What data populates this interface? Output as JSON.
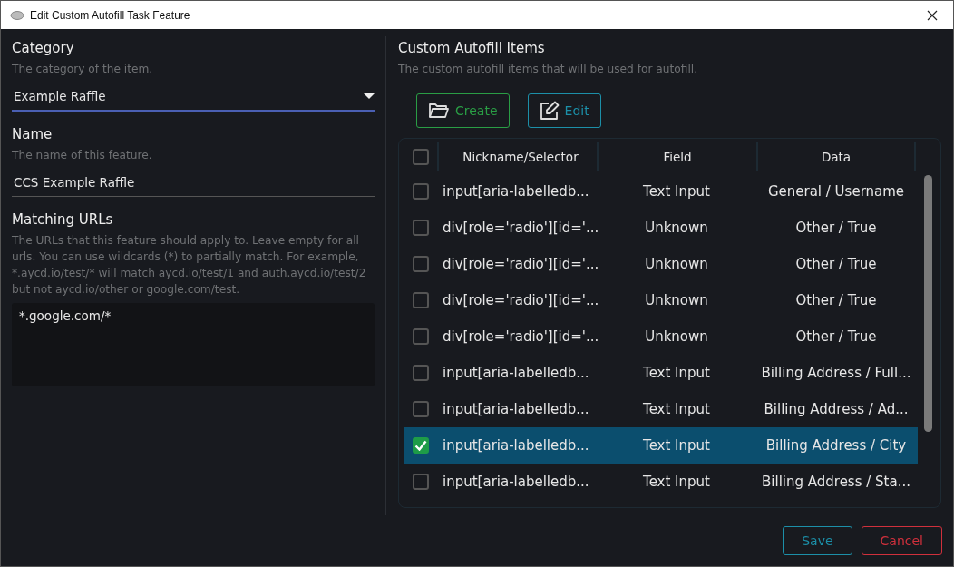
{
  "window": {
    "title": "Edit Custom Autofill Task Feature"
  },
  "left": {
    "category": {
      "label": "Category",
      "description": "The category of the item.",
      "value": "Example Raffle"
    },
    "name": {
      "label": "Name",
      "description": "The name of this feature.",
      "value": "CCS Example Raffle"
    },
    "matching_urls": {
      "label": "Matching URLs",
      "description": "The URLs that this feature should apply to. Leave empty for all urls. You can use wildcards (*) to partially match. For example, *.aycd.io/test/* will match aycd.io/test/1 and auth.aycd.io/test/2 but not aycd.io/other or google.com/test.",
      "value": "*.google.com/*"
    }
  },
  "right": {
    "title": "Custom Autofill Items",
    "description": "The custom autofill items that will be used for autofill.",
    "toolbar": [
      {
        "kind": "create",
        "label": "Create"
      },
      {
        "kind": "edit",
        "label": "Edit"
      }
    ],
    "table": {
      "header_checked": false,
      "columns": [
        "Nickname/Selector",
        "Field",
        "Data"
      ],
      "rows": [
        {
          "selector": "input[aria-labelledb...",
          "field": "Text Input",
          "data": "General / Username",
          "checked": false,
          "selected": false
        },
        {
          "selector": "div[role='radio'][id='...",
          "field": "Unknown",
          "data": "Other / True",
          "checked": false,
          "selected": false
        },
        {
          "selector": "div[role='radio'][id='...",
          "field": "Unknown",
          "data": "Other / True",
          "checked": false,
          "selected": false
        },
        {
          "selector": "div[role='radio'][id='...",
          "field": "Unknown",
          "data": "Other / True",
          "checked": false,
          "selected": false
        },
        {
          "selector": "div[role='radio'][id='...",
          "field": "Unknown",
          "data": "Other / True",
          "checked": false,
          "selected": false
        },
        {
          "selector": "input[aria-labelledb...",
          "field": "Text Input",
          "data": "Billing Address / Full...",
          "checked": false,
          "selected": false
        },
        {
          "selector": "input[aria-labelledb...",
          "field": "Text Input",
          "data": "Billing Address / Ad...",
          "checked": false,
          "selected": false
        },
        {
          "selector": "input[aria-labelledb...",
          "field": "Text Input",
          "data": "Billing Address / City",
          "checked": true,
          "selected": true
        },
        {
          "selector": "input[aria-labelledb...",
          "field": "Text Input",
          "data": "Billing Address / Sta...",
          "checked": false,
          "selected": false
        }
      ]
    }
  },
  "footer": [
    {
      "kind": "save",
      "label": "Save"
    },
    {
      "kind": "cancel",
      "label": "Cancel"
    }
  ]
}
